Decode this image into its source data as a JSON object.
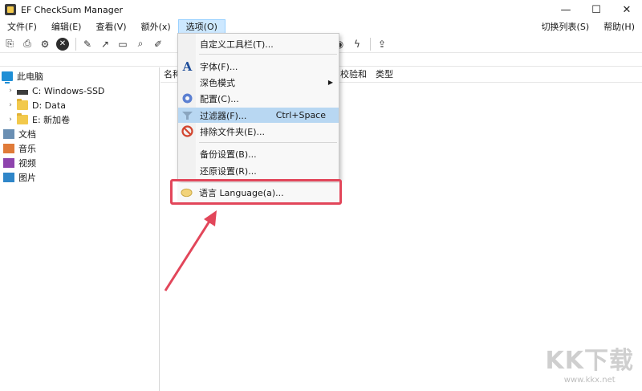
{
  "window": {
    "title": "EF CheckSum Manager",
    "minimize_glyph": "—",
    "maximize_glyph": "☐",
    "close_glyph": "✕"
  },
  "menubar": {
    "items": [
      "文件(F)",
      "编辑(E)",
      "查看(V)",
      "额外(x)",
      "选项(O)"
    ],
    "right_items": [
      "切换列表(S)",
      "帮助(H)"
    ]
  },
  "tree": {
    "items": [
      {
        "label": "此电脑",
        "icon": "computer-icon"
      },
      {
        "label": "C: Windows-SSD",
        "icon": "drive-icon"
      },
      {
        "label": "D: Data",
        "icon": "folder-icon"
      },
      {
        "label": "E: 新加卷",
        "icon": "folder-icon"
      },
      {
        "label": "文档",
        "icon": "documents-icon"
      },
      {
        "label": "音乐",
        "icon": "music-icon"
      },
      {
        "label": "视频",
        "icon": "video-icon"
      },
      {
        "label": "图片",
        "icon": "pictures-icon"
      }
    ]
  },
  "list": {
    "columns": [
      "名称",
      "校验和",
      "类型"
    ]
  },
  "options_menu": {
    "items": [
      {
        "label": "自定义工具栏(T)...",
        "icon": ""
      },
      {
        "label": "字体(F)...",
        "icon": "font-icon"
      },
      {
        "label": "深色模式",
        "icon": "",
        "submenu": true
      },
      {
        "label": "配置(C)...",
        "icon": "settings-gear-icon"
      },
      {
        "label": "过滤器(F)...",
        "icon": "filter-funnel-icon",
        "shortcut": "Ctrl+Space",
        "highlighted": true
      },
      {
        "label": "排除文件夹(E)...",
        "icon": "exclude-no-icon"
      },
      {
        "label": "备份设置(B)...",
        "icon": ""
      },
      {
        "label": "还原设置(R)...",
        "icon": ""
      }
    ],
    "language_item": {
      "label": "语言 Language(a)...",
      "icon": "language-speech-icon"
    }
  },
  "watermark": {
    "big": "KK下载",
    "small": "www.kkx.net"
  },
  "colors": {
    "highlight": "#b8d7f2",
    "annotation_red": "#e2465a",
    "menu_active": "#cde8ff"
  }
}
